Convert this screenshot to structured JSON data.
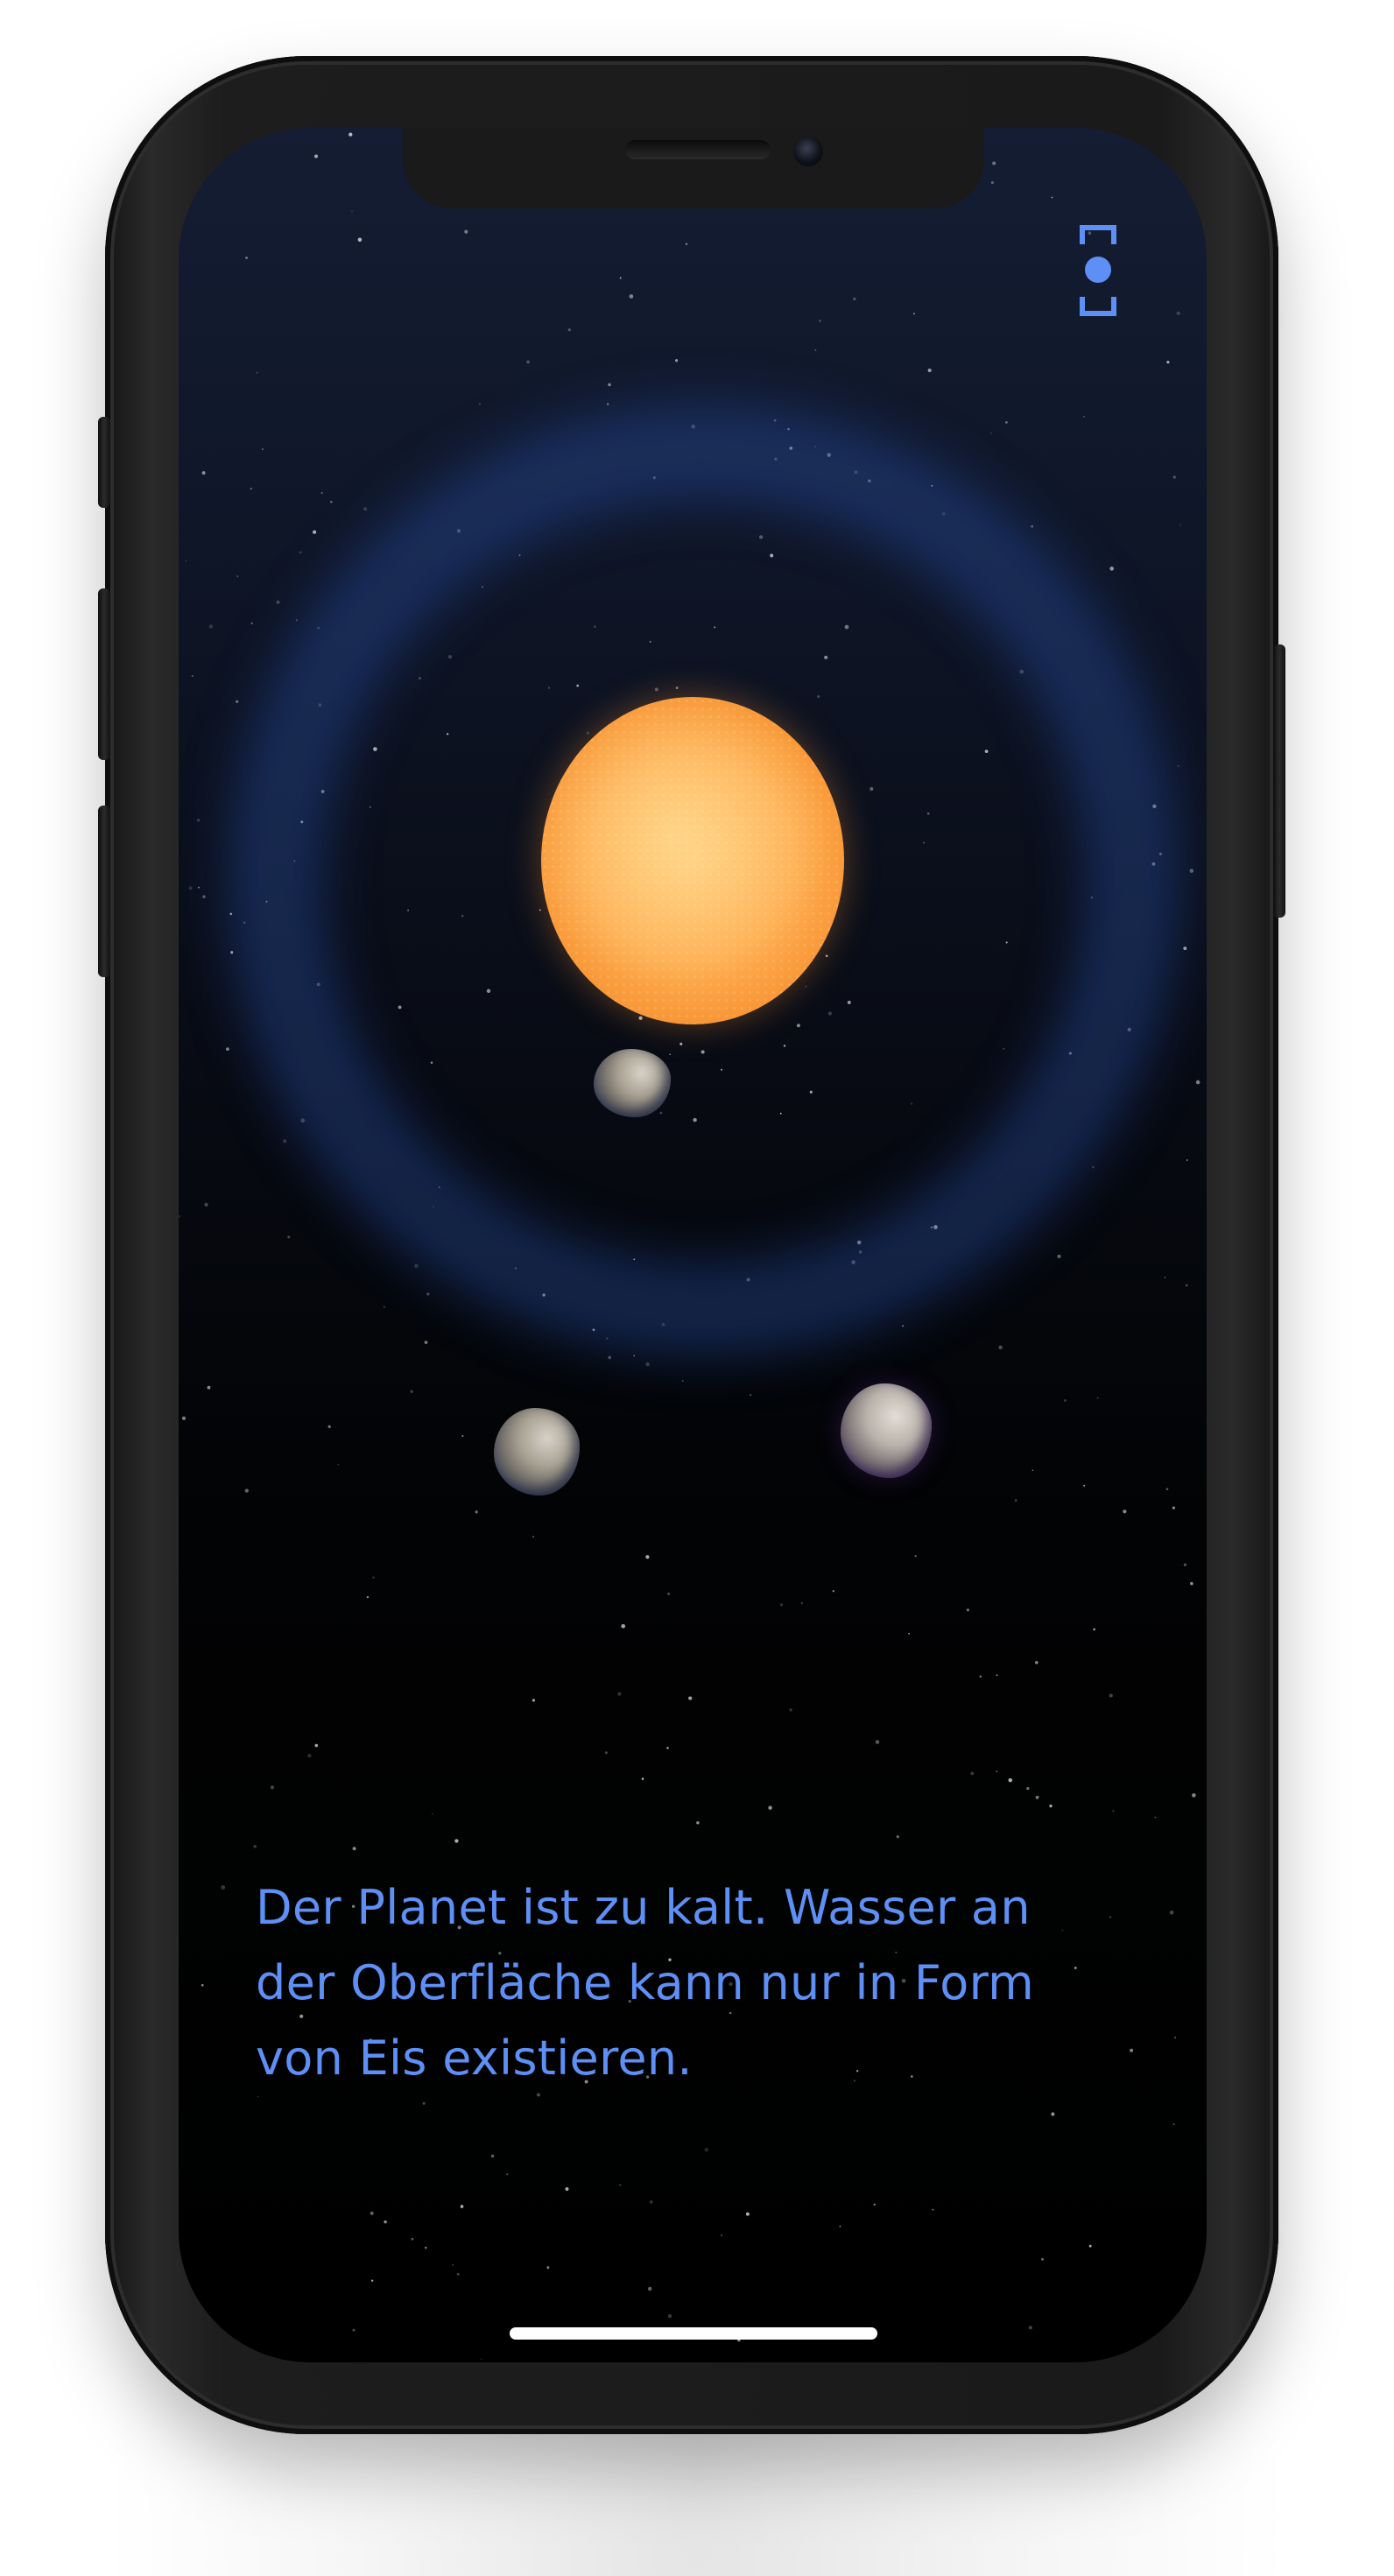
{
  "screen": {
    "message": "Der Planet ist zu kalt. Wasser an der Oberfläche kann nur in Form von Eis existieren."
  },
  "icons": {
    "focus": "focus-bracket-icon"
  },
  "colors": {
    "accent": "#5e8ff5",
    "sun": "#ffae52",
    "habitable_zone": "#2d55aa",
    "background": "#000000"
  }
}
